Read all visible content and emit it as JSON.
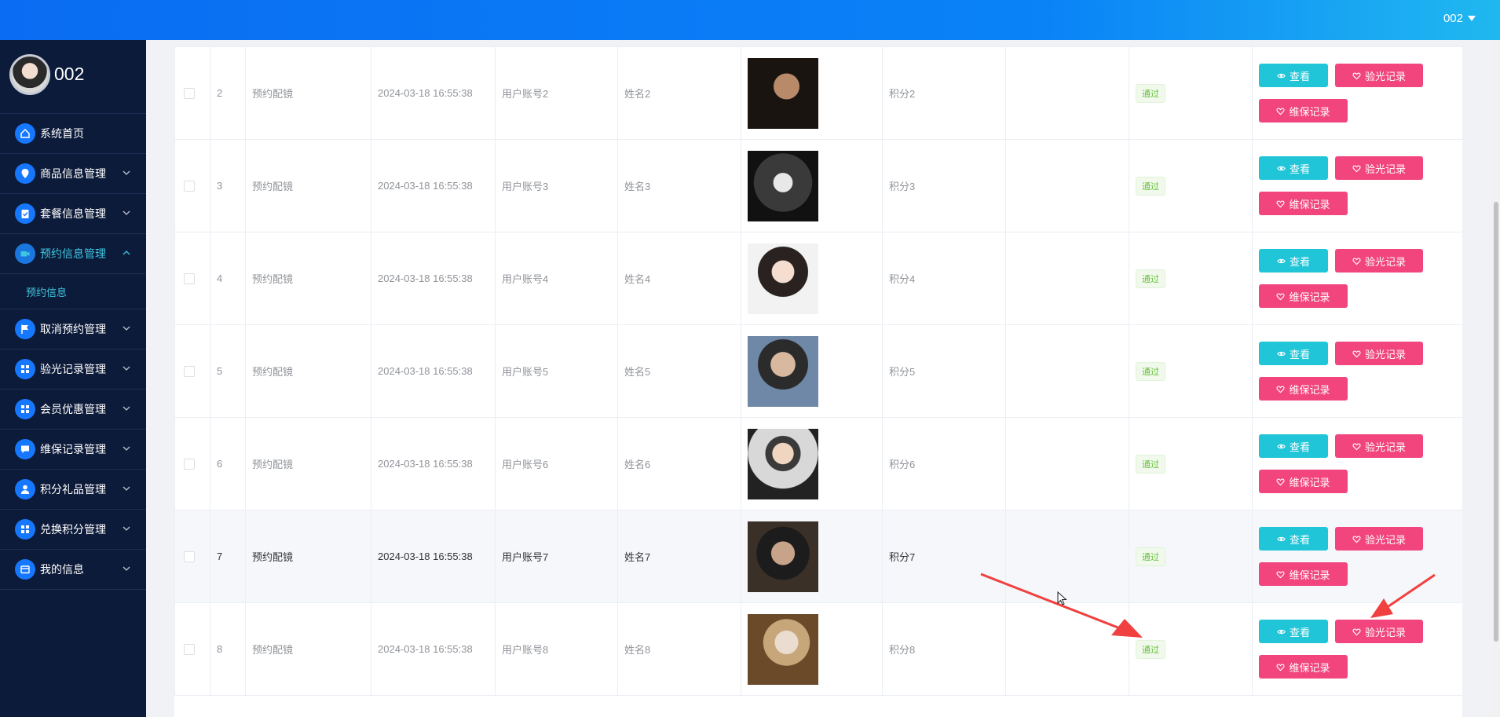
{
  "topbar": {
    "user": "002"
  },
  "sidebar": {
    "profile_name": "002",
    "items": [
      {
        "label": "系统首页",
        "icon": "home-icon",
        "has_arrow": false
      },
      {
        "label": "商品信息管理",
        "icon": "location-pin-icon",
        "has_arrow": true
      },
      {
        "label": "套餐信息管理",
        "icon": "clipboard-icon",
        "has_arrow": true
      },
      {
        "label": "预约信息管理",
        "icon": "video-icon",
        "has_arrow": true,
        "active": true
      },
      {
        "label": "取消预约管理",
        "icon": "flag-icon",
        "has_arrow": true
      },
      {
        "label": "验光记录管理",
        "icon": "grid-icon",
        "has_arrow": true
      },
      {
        "label": "会员优惠管理",
        "icon": "grid-icon",
        "has_arrow": true
      },
      {
        "label": "维保记录管理",
        "icon": "chat-icon",
        "has_arrow": true
      },
      {
        "label": "积分礼品管理",
        "icon": "user-icon",
        "has_arrow": true
      },
      {
        "label": "兑换积分管理",
        "icon": "grid-icon",
        "has_arrow": true
      },
      {
        "label": "我的信息",
        "icon": "card-icon",
        "has_arrow": true
      }
    ],
    "subitem": "预约信息"
  },
  "table": {
    "rows": [
      {
        "index": "2",
        "type": "预约配镜",
        "time": "2024-03-18 16:55:38",
        "account": "用户账号2",
        "name": "姓名2",
        "points": "积分2",
        "status": "通过"
      },
      {
        "index": "3",
        "type": "预约配镜",
        "time": "2024-03-18 16:55:38",
        "account": "用户账号3",
        "name": "姓名3",
        "points": "积分3",
        "status": "通过"
      },
      {
        "index": "4",
        "type": "预约配镜",
        "time": "2024-03-18 16:55:38",
        "account": "用户账号4",
        "name": "姓名4",
        "points": "积分4",
        "status": "通过"
      },
      {
        "index": "5",
        "type": "预约配镜",
        "time": "2024-03-18 16:55:38",
        "account": "用户账号5",
        "name": "姓名5",
        "points": "积分5",
        "status": "通过"
      },
      {
        "index": "6",
        "type": "预约配镜",
        "time": "2024-03-18 16:55:38",
        "account": "用户账号6",
        "name": "姓名6",
        "points": "积分6",
        "status": "通过"
      },
      {
        "index": "7",
        "type": "预约配镜",
        "time": "2024-03-18 16:55:38",
        "account": "用户账号7",
        "name": "姓名7",
        "points": "积分7",
        "status": "通过"
      },
      {
        "index": "8",
        "type": "预约配镜",
        "time": "2024-03-18 16:55:38",
        "account": "用户账号8",
        "name": "姓名8",
        "points": "积分8",
        "status": "通过"
      }
    ],
    "actions": {
      "view": "查看",
      "optometry": "验光记录",
      "maintenance": "维保记录"
    }
  },
  "colors": {
    "topbar": "#0a6cf2",
    "sidebar": "#0d1b3a",
    "accent": "#3fc6e0",
    "view_button": "#20c6d8",
    "pink_button": "#f2457e",
    "status_tag": "#67c23a",
    "annotation_arrow": "#f04040"
  }
}
